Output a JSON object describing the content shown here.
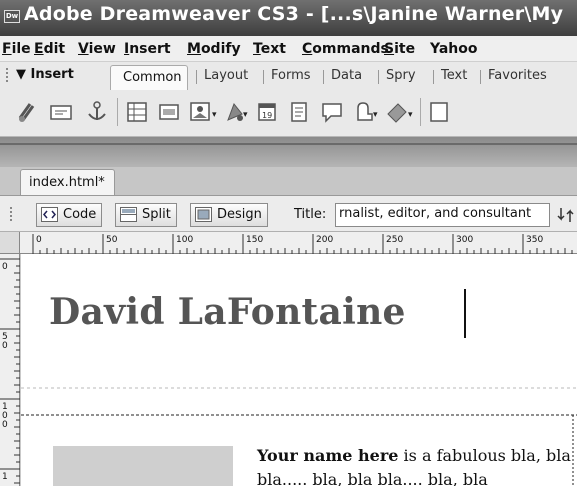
{
  "window": {
    "logo_text": "Dw",
    "title": "Adobe Dreamweaver CS3 - [...s\\Janine Warner\\My"
  },
  "menubar": {
    "items": [
      {
        "u": "F",
        "rest": "ile"
      },
      {
        "u": "E",
        "rest": "dit"
      },
      {
        "u": "V",
        "rest": "iew"
      },
      {
        "u": "I",
        "rest": "nsert"
      },
      {
        "u": "M",
        "rest": "odify"
      },
      {
        "u": "T",
        "rest": "ext"
      },
      {
        "u": "C",
        "rest": "ommands"
      },
      {
        "u": "S",
        "rest": "ite"
      },
      {
        "u": "",
        "rest": "Yahoo"
      }
    ]
  },
  "insert_bar": {
    "label": "▼ Insert",
    "active_tab": "Common",
    "tabs": [
      "Layout",
      "Forms",
      "Data",
      "Spry",
      "Text",
      "Favorites"
    ],
    "icons": [
      "hyperlink-icon",
      "email-link-icon",
      "named-anchor-icon",
      "table-icon",
      "div-icon",
      "image-icon",
      "media-icon",
      "date-icon",
      "server-include-icon",
      "comment-icon",
      "head-icon",
      "script-icon",
      "templates-icon"
    ]
  },
  "document": {
    "tab_label": "index.html*",
    "views": {
      "code": "Code",
      "split": "Split",
      "design": "Design"
    },
    "title_label": "Title:",
    "title_value": "rnalist, editor, and consultant"
  },
  "ruler": {
    "top_labels": [
      "0",
      "50",
      "100",
      "150",
      "200",
      "250",
      "300",
      "350"
    ],
    "left_labels": [
      "0",
      "5\n0",
      "1\n0\n0",
      "1"
    ]
  },
  "page": {
    "heading": "David LaFontaine",
    "para_bold": "Your name here",
    "para_rest": " is a fabulous bla, bla bla..... bla, bla bla.... bla, bla"
  }
}
